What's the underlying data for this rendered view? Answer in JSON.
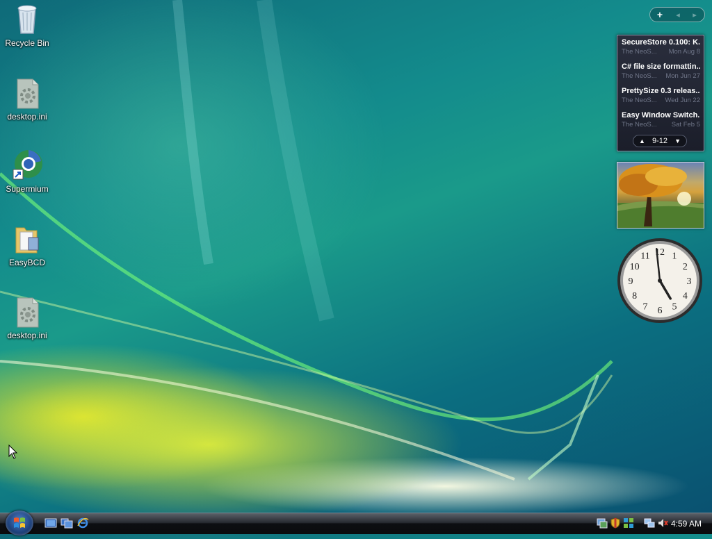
{
  "desktop": {
    "icons": [
      {
        "label": "Recycle Bin",
        "icon": "recycle-bin-icon"
      },
      {
        "label": "desktop.ini",
        "icon": "settings-file-icon"
      },
      {
        "label": "Supermium",
        "icon": "browser-icon"
      },
      {
        "label": "EasyBCD",
        "icon": "folder-icon"
      },
      {
        "label": "desktop.ini",
        "icon": "settings-file-icon"
      }
    ]
  },
  "sidebar": {
    "add_label": "+",
    "prev_label": "◂",
    "next_label": "▸"
  },
  "feed_gadget": {
    "items": [
      {
        "title": "SecureStore 0.100: K...",
        "source": "The NeoS...",
        "date": "Mon Aug 8"
      },
      {
        "title": "C# file size formattin...",
        "source": "The NeoS...",
        "date": "Mon Jun 27"
      },
      {
        "title": "PrettySize 0.3 releas...",
        "source": "The NeoS...",
        "date": "Wed Jun 22"
      },
      {
        "title": "Easy Window Switch...",
        "source": "The NeoS...",
        "date": "Sat Feb 5"
      }
    ],
    "page_range": "9-12"
  },
  "clock_gadget": {
    "numbers": [
      "12",
      "1",
      "2",
      "3",
      "4",
      "5",
      "6",
      "7",
      "8",
      "9",
      "10",
      "11"
    ],
    "hour": 4,
    "minute": 59
  },
  "taskbar": {
    "time": "4:59 AM",
    "quick_launch": [
      "show-desktop-icon",
      "switch-windows-icon",
      "internet-explorer-icon"
    ],
    "tray_icons": [
      "network-status-icon",
      "security-shield-icon",
      "windows-update-icon",
      "network-icon",
      "volume-muted-icon"
    ]
  },
  "colors": {
    "taskbar": "#0d0f12",
    "gadget_bg": "#1b1e2a",
    "accent": "#1a9a8a"
  }
}
